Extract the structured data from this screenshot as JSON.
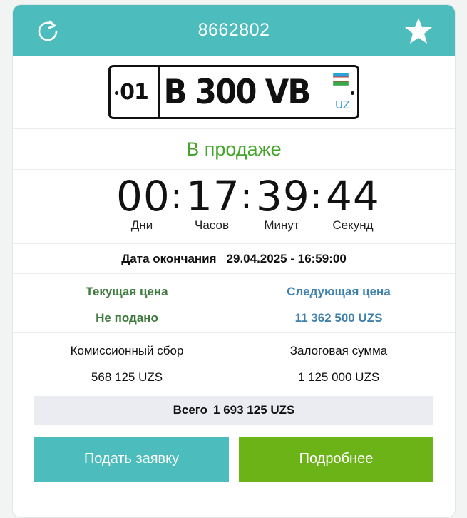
{
  "header": {
    "lot_number": "8662802"
  },
  "plate": {
    "region": "01",
    "number": "B 300 VB",
    "country": "UZ"
  },
  "status": "В продаже",
  "countdown": {
    "days": "00",
    "hours": "17",
    "minutes": "39",
    "seconds": "44",
    "days_label": "Дни",
    "hours_label": "Часов",
    "minutes_label": "Минут",
    "seconds_label": "Секунд"
  },
  "end_date": {
    "label": "Дата окончания",
    "value": "29.04.2025 - 16:59:00"
  },
  "prices": {
    "current_label": "Текущая цена",
    "current_value": "Не подано",
    "next_label": "Следующая цена",
    "next_value": "11 362 500 UZS"
  },
  "fees": {
    "commission_label": "Комиссионный сбор",
    "commission_value": "568 125 UZS",
    "deposit_label": "Залоговая сумма",
    "deposit_value": "1 125 000 UZS"
  },
  "total": {
    "label": "Всего",
    "value": "1 693 125 UZS"
  },
  "buttons": {
    "apply": "Подать заявку",
    "details": "Подробнее"
  },
  "colors": {
    "header": "#4cbdbc",
    "status": "#44a52a",
    "apply_button": "#4cbdbc",
    "details_button": "#6bb317",
    "current_price": "#3f7a3f",
    "next_price": "#3f80ad"
  },
  "icons": {
    "left": "refresh-icon",
    "right": "star-icon"
  }
}
